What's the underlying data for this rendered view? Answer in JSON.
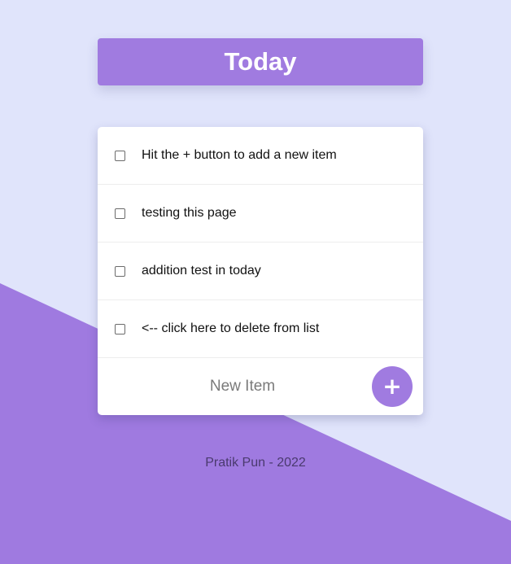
{
  "header": {
    "title": "Today"
  },
  "list": {
    "items": [
      {
        "text": "Hit the + button to add a new item",
        "checked": false
      },
      {
        "text": "testing this page",
        "checked": false
      },
      {
        "text": "addition test in today",
        "checked": false
      },
      {
        "text": "<-- click here to delete from list",
        "checked": false
      }
    ]
  },
  "new_item": {
    "placeholder": "New Item",
    "add_label": "+"
  },
  "footer": {
    "text": "Pratik Pun - 2022"
  },
  "colors": {
    "background": "#e0e4fb",
    "accent": "#a07be0",
    "diagonal": "#9f7ae0"
  }
}
